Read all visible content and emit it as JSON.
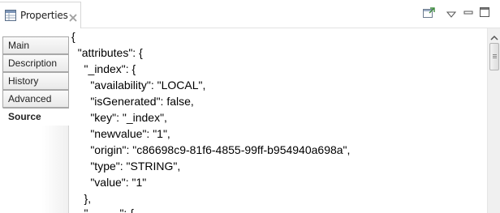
{
  "view": {
    "title": "Properties"
  },
  "nav": {
    "items": [
      {
        "label": "Main",
        "active": false
      },
      {
        "label": "Description",
        "active": false
      },
      {
        "label": "History",
        "active": false
      },
      {
        "label": "Advanced",
        "active": false
      },
      {
        "label": "Source",
        "active": true
      }
    ]
  },
  "editor": {
    "lines": [
      "{",
      "  \"attributes\": {",
      "    \"_index\": {",
      "      \"availability\": \"LOCAL\",",
      "      \"isGenerated\": false,",
      "      \"key\": \"_index\",",
      "      \"newvalue\": \"1\",",
      "      \"origin\": \"c86698c9-81f6-4855-99ff-b954940a698a\",",
      "      \"type\": \"STRING\",",
      "      \"value\": \"1\"",
      "    },",
      "    \"_____\": {"
    ]
  },
  "icons": {
    "view_tab": "properties-table-icon",
    "close": "close-x-icon",
    "pin": "pin-editor-icon",
    "menu": "view-menu-triangle-icon",
    "minimize": "minimize-icon",
    "maximize": "maximize-icon"
  }
}
